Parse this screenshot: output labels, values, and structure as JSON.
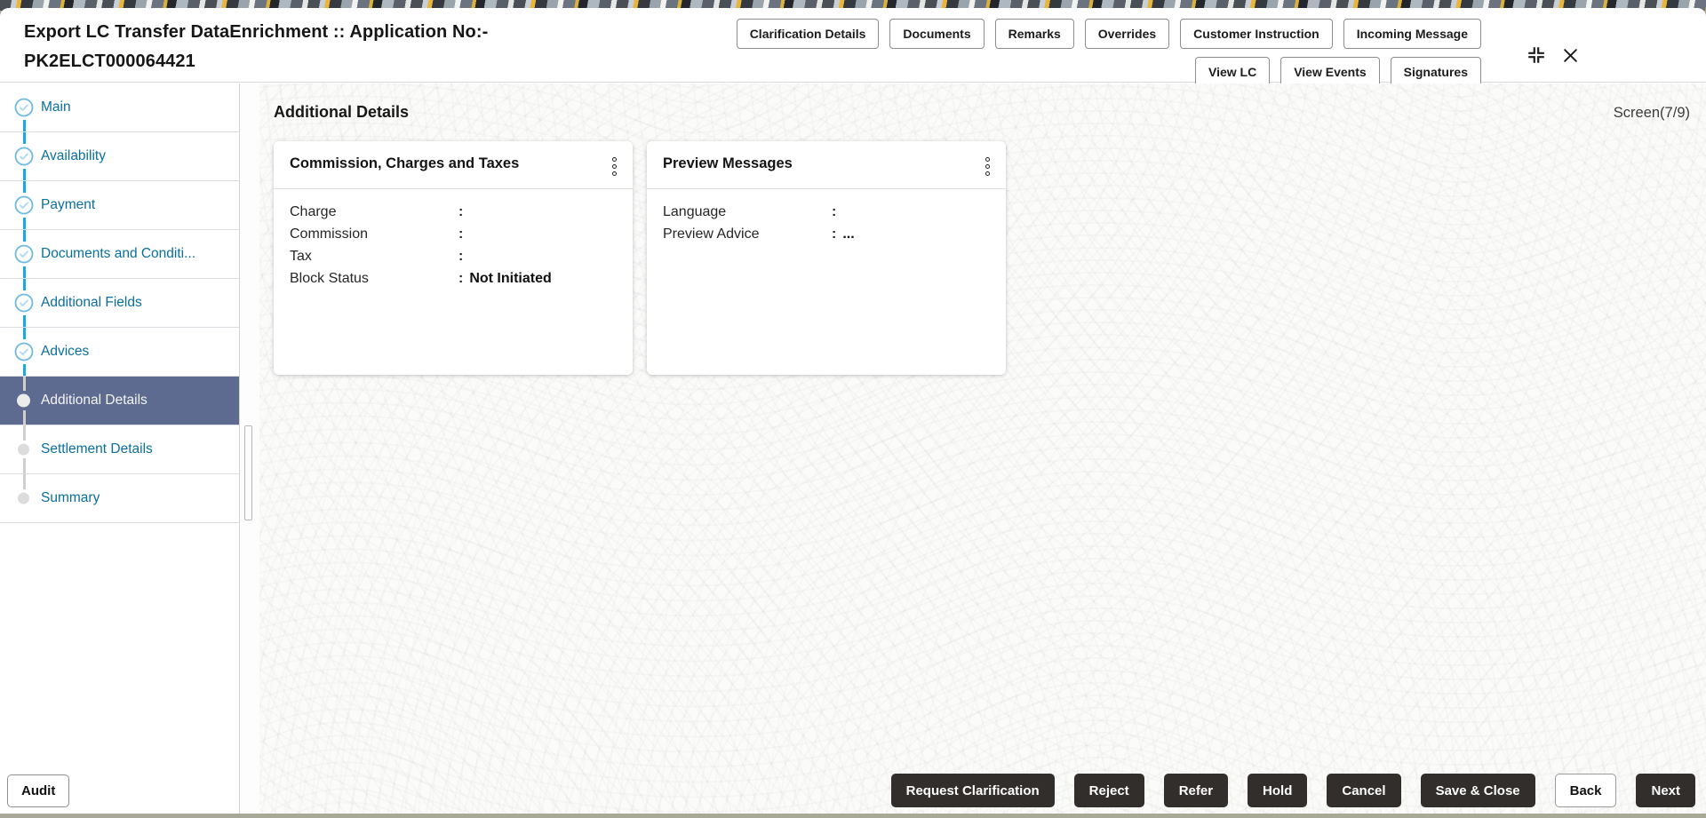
{
  "colon": ":",
  "window": {
    "title_line1": "Export LC Transfer DataEnrichment :: Application No:-",
    "title_line2": "PK2ELCT000064421"
  },
  "header": {
    "actions_row1": [
      "Clarification Details",
      "Documents",
      "Remarks",
      "Overrides",
      "Customer Instruction",
      "Incoming Message"
    ],
    "actions_row2": [
      "View LC",
      "View Events",
      "Signatures"
    ],
    "icons": {
      "restore": "restore-window-icon",
      "close": "close-icon"
    }
  },
  "sidebar": {
    "items": [
      {
        "label": "Main",
        "state": "completed"
      },
      {
        "label": "Availability",
        "state": "completed"
      },
      {
        "label": "Payment",
        "state": "completed"
      },
      {
        "label": "Documents and Conditi...",
        "state": "completed"
      },
      {
        "label": "Additional Fields",
        "state": "completed"
      },
      {
        "label": "Advices",
        "state": "completed"
      },
      {
        "label": "Additional Details",
        "state": "current"
      },
      {
        "label": "Settlement Details",
        "state": "upcoming"
      },
      {
        "label": "Summary",
        "state": "upcoming"
      }
    ]
  },
  "main": {
    "heading": "Additional Details",
    "screen_indicator": "Screen(7/9)",
    "cards": [
      {
        "title": "Commission, Charges and Taxes",
        "menu_icon": "kebab-menu-icon",
        "fields": [
          {
            "label": "Charge",
            "value": ""
          },
          {
            "label": "Commission",
            "value": ""
          },
          {
            "label": "Tax",
            "value": ""
          },
          {
            "label": "Block Status",
            "value": "Not Initiated"
          }
        ]
      },
      {
        "title": "Preview Messages",
        "menu_icon": "kebab-menu-icon",
        "fields": [
          {
            "label": "Language",
            "value": ""
          },
          {
            "label": "Preview Advice",
            "value": "..."
          }
        ]
      }
    ]
  },
  "footer": {
    "audit": "Audit",
    "actions": [
      {
        "label": "Request Clarification",
        "variant": "dark"
      },
      {
        "label": "Reject",
        "variant": "dark"
      },
      {
        "label": "Refer",
        "variant": "dark"
      },
      {
        "label": "Hold",
        "variant": "dark"
      },
      {
        "label": "Cancel",
        "variant": "dark"
      },
      {
        "label": "Save & Close",
        "variant": "dark"
      },
      {
        "label": "Back",
        "variant": "light"
      },
      {
        "label": "Next",
        "variant": "dark"
      }
    ]
  },
  "colors": {
    "link_blue": "#0a6f9d",
    "step_line_blue": "#1aa9e0",
    "selected_item_bg": "#5e6b91",
    "dark_button": "#322e2b",
    "banner_yellow": "#e9b63b"
  }
}
